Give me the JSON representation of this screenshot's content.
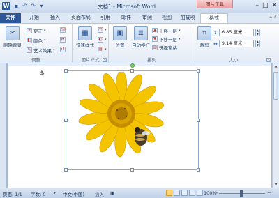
{
  "window": {
    "title": "文档1 - Microsoft Word",
    "app_icon_letter": "W",
    "quick_access": [
      "save",
      "undo",
      "redo",
      "customize"
    ],
    "contextual_tab_group": "图片工具",
    "buttons": [
      "minimize",
      "maximize",
      "close"
    ]
  },
  "tabs": [
    {
      "label": "文件"
    },
    {
      "label": "开始"
    },
    {
      "label": "插入"
    },
    {
      "label": "页面布局"
    },
    {
      "label": "引用"
    },
    {
      "label": "邮件"
    },
    {
      "label": "审阅"
    },
    {
      "label": "视图"
    },
    {
      "label": "加载项"
    },
    {
      "label": "格式"
    }
  ],
  "ribbon": {
    "adjust": {
      "remove_bg": "删除背景",
      "corrections": "更正",
      "color": "颜色",
      "artistic": "艺术效果",
      "label": "调整"
    },
    "styles": {
      "quick_styles": "快速样式",
      "label": "图片样式"
    },
    "arrange": {
      "position": "位置",
      "wrap_text": "自动换行",
      "bring_forward": "上移一层",
      "send_backward": "下移一层",
      "selection_pane": "选择窗格",
      "label": "排列"
    },
    "size": {
      "crop": "裁剪",
      "height": "6.85 厘米",
      "width": "9.14 厘米",
      "label": "大小"
    }
  },
  "statusbar": {
    "page": "页面: 1/1",
    "words": "字数: 0",
    "language": "中文(中国)",
    "mode": "插入",
    "zoom": "100%"
  },
  "colors": {
    "file_tab": "#2b579a",
    "contextual_tab": "#e9a3a3",
    "petal": "#f5c400",
    "center": "#d9a400",
    "selection_border": "#8faad1"
  }
}
